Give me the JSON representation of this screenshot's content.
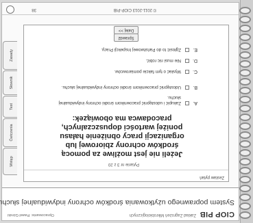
{
  "header": {
    "brand": "CIOP PIB",
    "institute": "Zakład Zagrożeń Mikrobiologicznych",
    "title": "System poprawnego użytkowania środków ochrony indywidualnej słuchu",
    "author": "Opracowanie: Paweł Górski"
  },
  "content": {
    "section_name": "Zestaw pytań",
    "question_number": "Pytanie nr 3 z 20",
    "question": "Jeżeli nie jest możliwe za pomocą środków ochrony zbiorowej lub organizacji pracy obniżenie hałasu poniżej wartości dopuszczalnych, pracodawca ma obowiązek:",
    "answers": [
      {
        "letter": "A.",
        "text": "Zakupić i udostępnić pracownikom środki ochrony indywidualnej słuchu."
      },
      {
        "letter": "B.",
        "text": "Udostępnić pracownikom środki ochrony indywidualnej słuchu."
      },
      {
        "letter": "C.",
        "text": "Wysłać o tym fakcie pomiarowców."
      },
      {
        "letter": "D.",
        "text": "Nie musi nic robić."
      },
      {
        "letter": "E.",
        "text": "Zgłosić to do Państwowej Inspekcji Pracy."
      }
    ],
    "buttons": {
      "check": "Sprawdź",
      "next": "Dalej >>"
    }
  },
  "tabs": [
    "Wstęp",
    "Ćwiczenia",
    "Test",
    "Słownik",
    "Zasady"
  ],
  "footer": {
    "brand": "© 2011-2013 CIOP-PIB",
    "page": "38"
  },
  "icons": {
    "binder": "spiral-binding",
    "logo": "circle-logo-icon"
  }
}
